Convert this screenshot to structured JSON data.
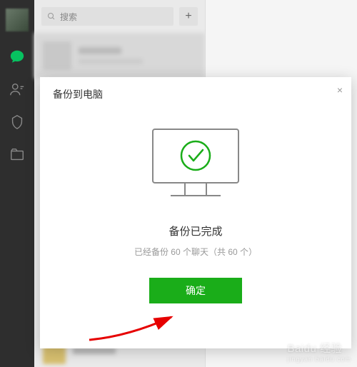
{
  "sidebar": {
    "icons": [
      "chat",
      "contacts",
      "collect",
      "files"
    ]
  },
  "search": {
    "placeholder": "搜索"
  },
  "modal": {
    "title": "备份到电脑",
    "status_title": "备份已完成",
    "status_sub": "已经备份 60 个聊天（共 60 个）",
    "ok_label": "确定"
  },
  "watermark": {
    "brand": "Baidu 经验",
    "sub": "jingyan.baidu.com"
  },
  "colors": {
    "accent": "#07c160",
    "ok_green": "#1aad19"
  }
}
